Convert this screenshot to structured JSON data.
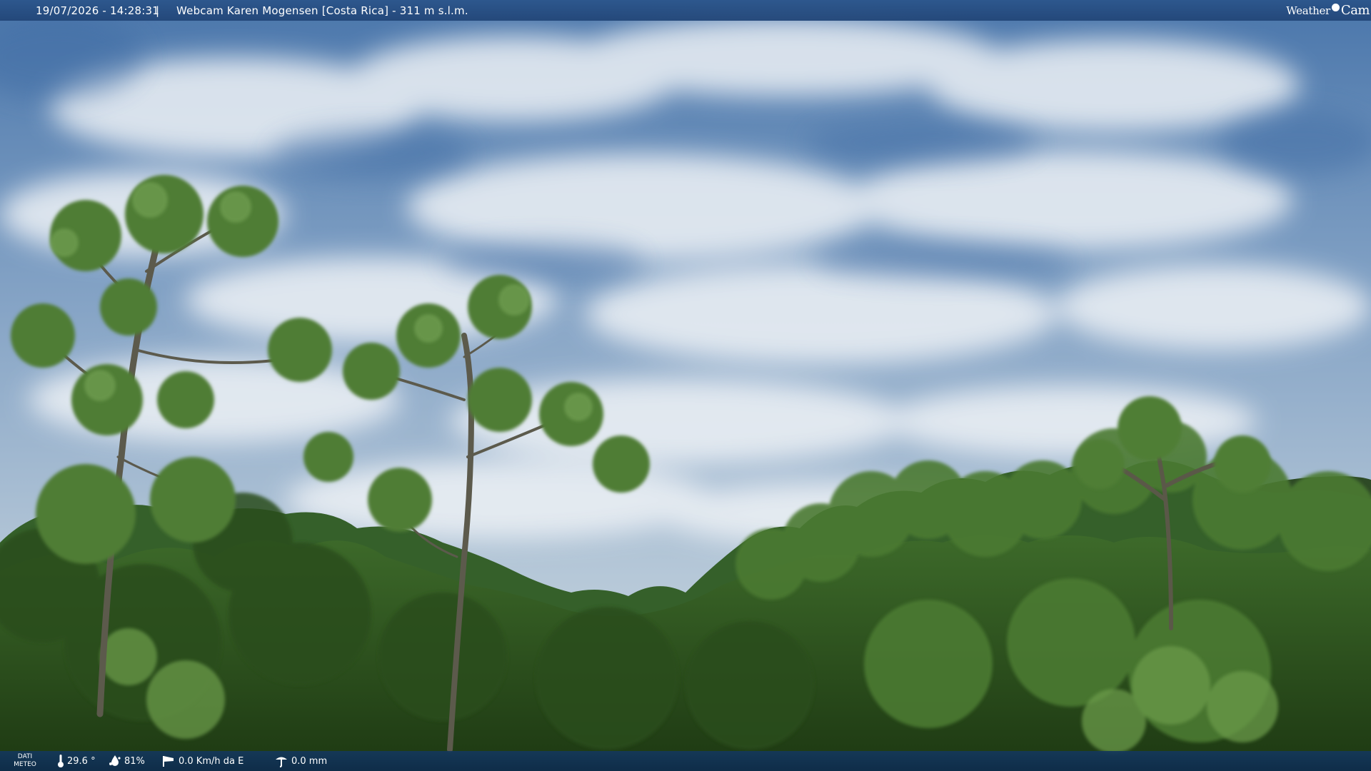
{
  "overlay": {
    "timestamp": "19/07/2026 - 14:28:31",
    "separator": "|",
    "camera_label": "Webcam Karen Mogensen [Costa Rica] - 311 m s.l.m.",
    "logo": {
      "part1": "Weather",
      "part2": "Cam"
    }
  },
  "weather": {
    "section_label_line1": "DATI",
    "section_label_line2": "METEO",
    "temperature": "29.6 °",
    "humidity": "81%",
    "wind": "0.0 Km/h da E",
    "rain": "0.0 mm",
    "icons": {
      "temperature": "thermometer-icon",
      "humidity": "humidity-drop-icon",
      "wind": "wind-sock-icon",
      "rain": "rain-gauge-icon"
    }
  },
  "colors": {
    "sky_top": "#4d79ad",
    "sky_bottom": "#c3d2de",
    "canopy_dark": "#1f3d14",
    "canopy_light": "#5b8a3c",
    "overlay_bar": "#2c568c"
  }
}
